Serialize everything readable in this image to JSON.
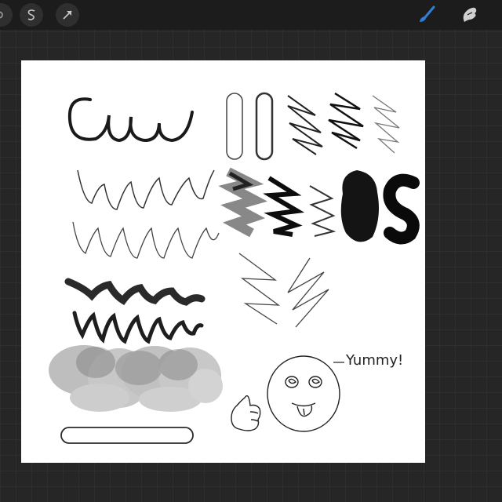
{
  "app": {
    "toolbar": {
      "left_tools": [
        "partial-tool-icon",
        "selection-s-icon",
        "transform-arrow-icon"
      ],
      "right_tools": [
        "brush-icon",
        "smudge-icon"
      ],
      "active_color": "#2f7fd8"
    },
    "canvas": {
      "annotation_text": "Yummy!"
    }
  }
}
